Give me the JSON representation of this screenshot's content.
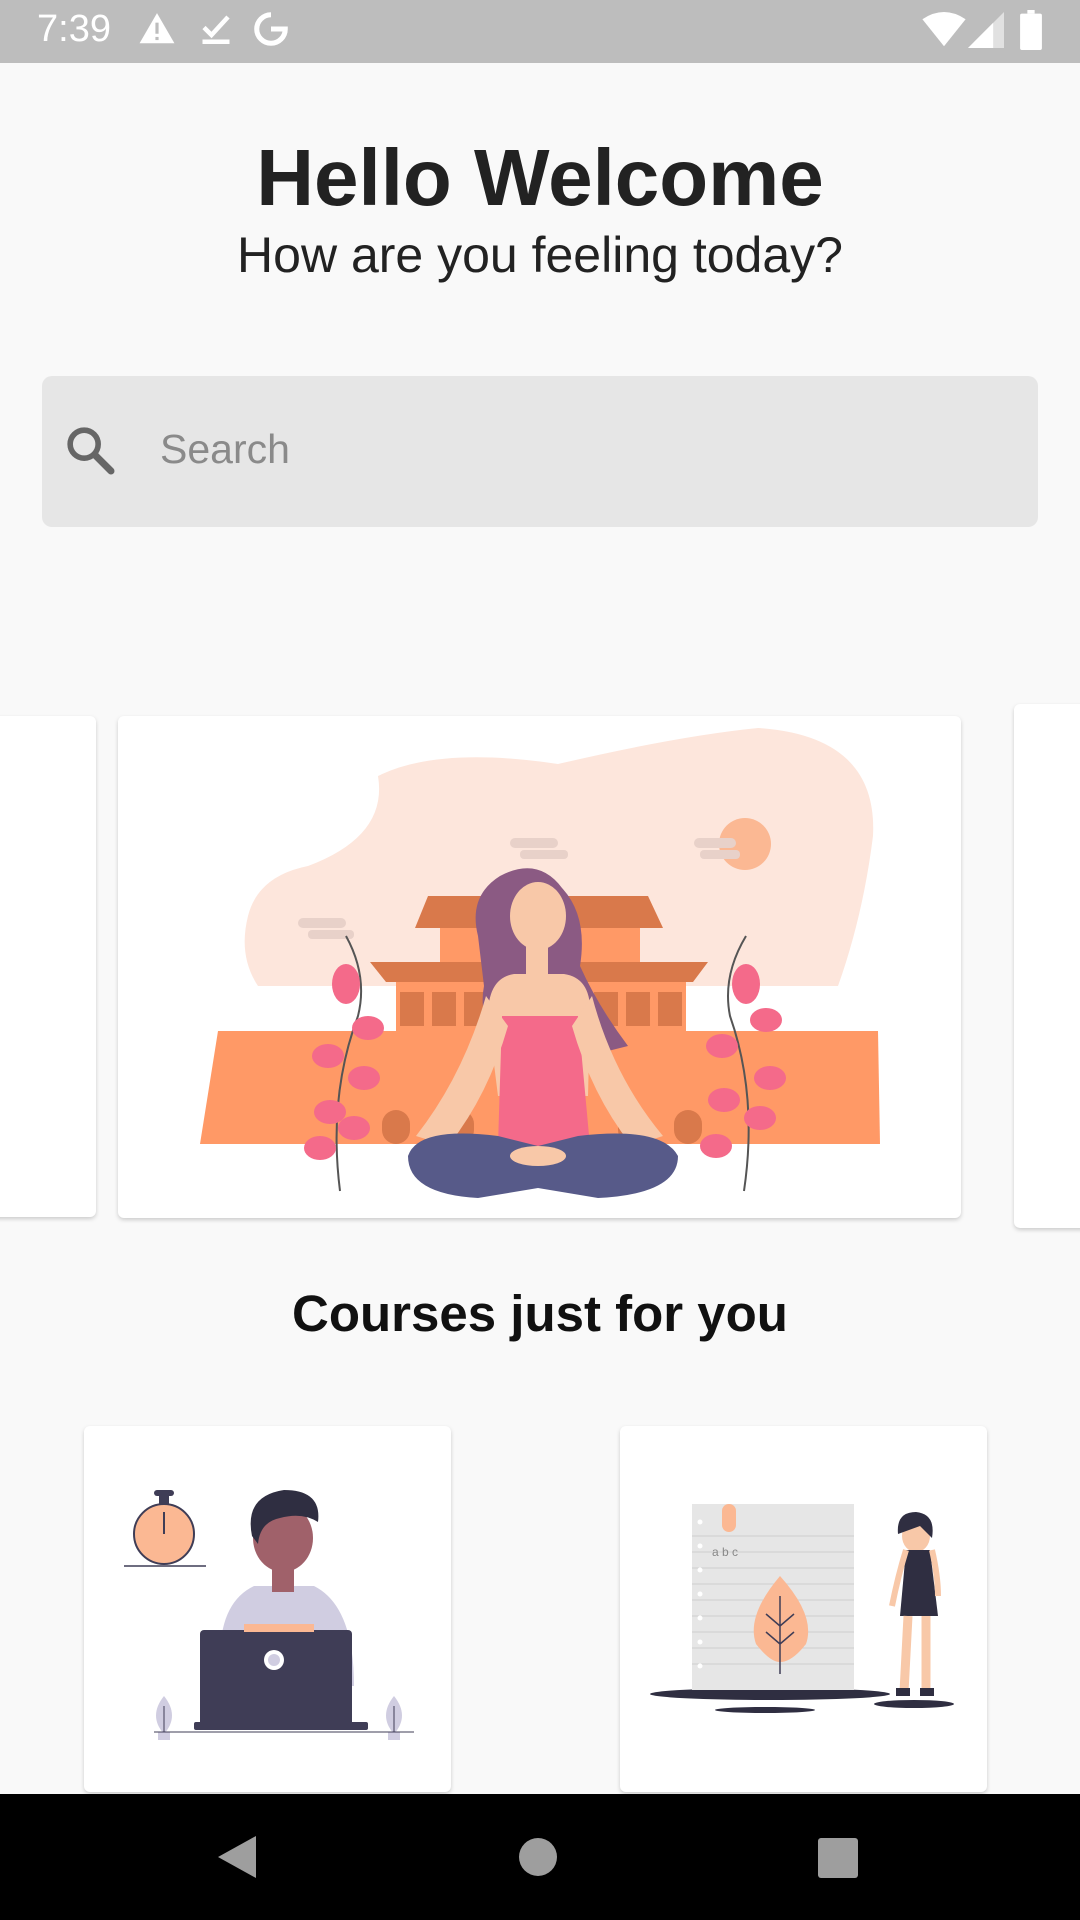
{
  "status_bar": {
    "time": "7:39",
    "icons_left": [
      "warning-icon",
      "check-download-icon",
      "google-icon"
    ],
    "icons_right": [
      "wifi-icon",
      "signal-icon",
      "battery-icon"
    ]
  },
  "header": {
    "title": "Hello Welcome",
    "subtitle": "How are you feeling today?"
  },
  "search": {
    "placeholder": "Search"
  },
  "carousel": {
    "items": [
      {
        "illustration": "meditation-temple-illustration"
      }
    ]
  },
  "courses": {
    "section_title": "Courses just for you",
    "items": [
      {
        "illustration": "person-laptop-timer-illustration"
      },
      {
        "illustration": "woman-notebook-leaf-illustration",
        "note_text": "a b c"
      }
    ]
  },
  "nav_bar": {
    "buttons": [
      "back-icon",
      "home-icon",
      "recents-icon"
    ]
  },
  "colors": {
    "status_bar": "#bdbdbd",
    "background": "#f9f9f9",
    "search_bg": "#e6e6e6",
    "accent_orange": "#ff9966",
    "accent_pink": "#f46a8a",
    "navy": "#3f3d56"
  }
}
